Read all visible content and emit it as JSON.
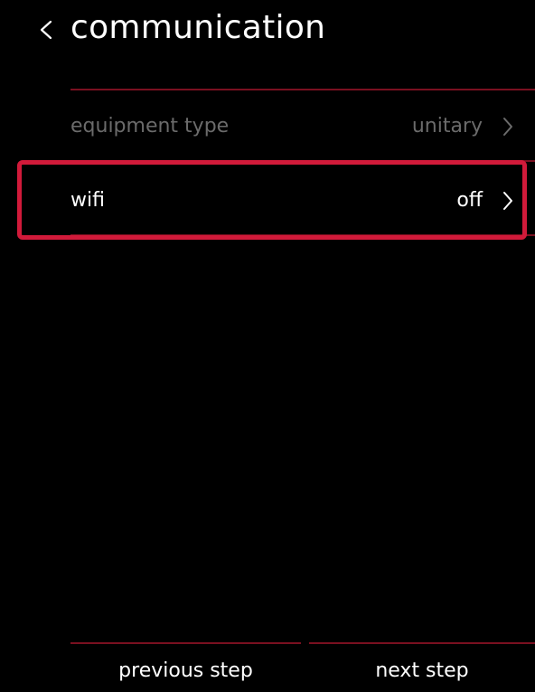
{
  "header": {
    "title": "communication",
    "back_icon": "chevron-left-icon"
  },
  "settings": {
    "items": [
      {
        "label": "equipment type",
        "value": "unitary",
        "state": "disabled"
      },
      {
        "label": "wifi",
        "value": "off",
        "state": "enabled"
      }
    ]
  },
  "footer": {
    "previous_label": "previous step",
    "next_label": "next step"
  },
  "colors": {
    "background": "#000000",
    "divider": "#7a1020",
    "highlight": "#d11a3a",
    "text_primary": "#ffffff",
    "text_muted": "#6b6b6b"
  }
}
